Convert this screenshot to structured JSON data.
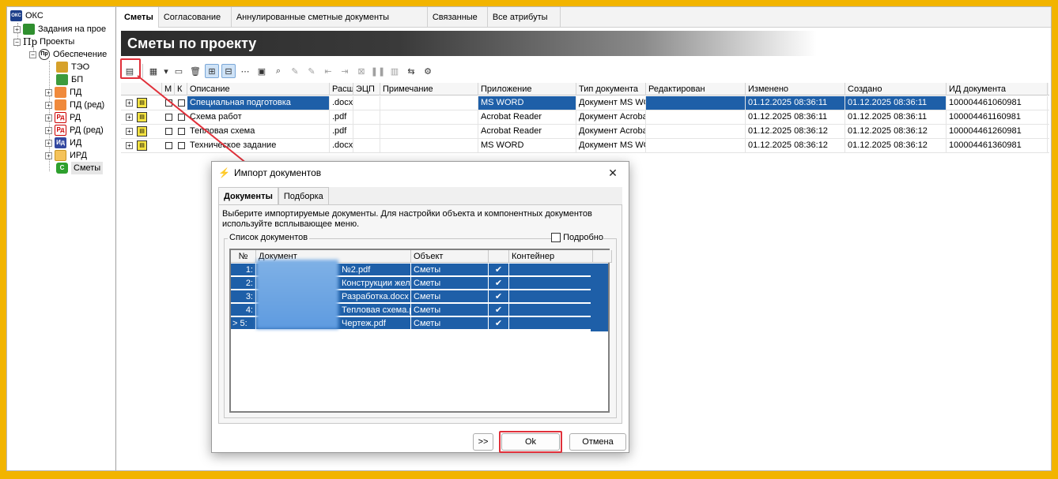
{
  "tree": {
    "items": [
      {
        "label": "ОКС",
        "icon": "oks-icon"
      },
      {
        "label": "Задания на прое",
        "icon": "folder-green-icon"
      },
      {
        "label": "Проекты",
        "icon": "project-icon",
        "prefix": "Пр"
      },
      {
        "label": "Обеспечение",
        "icon": "circle-pr-icon",
        "prefix": "Пр"
      },
      {
        "label": "ТЭО",
        "icon": "books-icon"
      },
      {
        "label": "БП",
        "icon": "book-icon"
      },
      {
        "label": "ПД",
        "icon": "folder-orange-icon"
      },
      {
        "label": "ПД (ред)",
        "icon": "folder-orange-icon"
      },
      {
        "label": "РД",
        "icon": "rd-icon",
        "prefix": "Рд"
      },
      {
        "label": "РД (ред)",
        "icon": "rd-icon",
        "prefix": "Рд"
      },
      {
        "label": "ИД",
        "icon": "id-icon",
        "prefix": "Ид"
      },
      {
        "label": "ИРД",
        "icon": "folder-yellow-icon"
      },
      {
        "label": "Сметы",
        "icon": "c-icon",
        "prefix": "С"
      }
    ]
  },
  "tabs": [
    {
      "label": "Сметы",
      "active": true
    },
    {
      "label": "Согласование"
    },
    {
      "label": "Аннулированные сметные документы"
    },
    {
      "label": "Связанные"
    },
    {
      "label": "Все атрибуты"
    }
  ],
  "page_title": "Сметы по проекту",
  "grid": {
    "columns": [
      "М",
      "К",
      "Описание",
      "Расш",
      "ЭЦП",
      "Примечание",
      "Приложение",
      "Тип документа",
      "Редактирован",
      "Изменено",
      "Создано",
      "ИД документа"
    ],
    "rows": [
      {
        "description": "Специальная подготовка",
        "ext": ".docx",
        "app": "MS WORD",
        "type": "Документ MS WO",
        "changed": "01.12.2025 08:36:11",
        "created": "01.12.2025 08:36:11",
        "id": "100004461060981",
        "selected": true
      },
      {
        "description": "Схема работ",
        "ext": ".pdf",
        "app": "Acrobat Reader",
        "type": "Документ Acroba",
        "changed": "01.12.2025 08:36:11",
        "created": "01.12.2025 08:36:11",
        "id": "100004461160981"
      },
      {
        "description": "Тепловая схема",
        "ext": ".pdf",
        "app": "Acrobat Reader",
        "type": "Документ Acroba",
        "changed": "01.12.2025 08:36:12",
        "created": "01.12.2025 08:36:12",
        "id": "100004461260981"
      },
      {
        "description": "Техническое задание",
        "ext": ".docx",
        "app": "MS WORD",
        "type": "Документ MS WO",
        "changed": "01.12.2025 08:36:12",
        "created": "01.12.2025 08:36:12",
        "id": "100004461360981"
      }
    ]
  },
  "dialog": {
    "title": "Импорт документов",
    "tabs": [
      {
        "label": "Документы",
        "active": true
      },
      {
        "label": "Подборка"
      }
    ],
    "info_line1": "Выберите импортируемые документы. Для настройки объекта и компонентных документов",
    "info_line2": "используйте всплывающее меню.",
    "group_label": "Список документов",
    "detail_label": "Подробно",
    "columns": [
      "№",
      "Документ",
      "Объект",
      "",
      "Контейнер"
    ],
    "rows": [
      {
        "num": "1:",
        "doc": "№2.pdf",
        "object": "Сметы",
        "check": "✔"
      },
      {
        "num": "2:",
        "doc": "Конструкции жел",
        "object": "Сметы",
        "check": "✔"
      },
      {
        "num": "3:",
        "doc": "Разработка.docx",
        "object": "Сметы",
        "check": "✔"
      },
      {
        "num": "4:",
        "doc": "Тепловая схема.p",
        "object": "Сметы",
        "check": "✔"
      },
      {
        "num": "> 5:",
        "doc": "Чертеж.pdf",
        "object": "Сметы",
        "check": "✔"
      }
    ],
    "btn_more": ">>",
    "btn_ok": "Ok",
    "btn_cancel": "Отмена",
    "close": "✕"
  },
  "colors": {
    "accent": "#1e5fa8",
    "highlight": "#e0303a",
    "background": "#f2b400"
  }
}
